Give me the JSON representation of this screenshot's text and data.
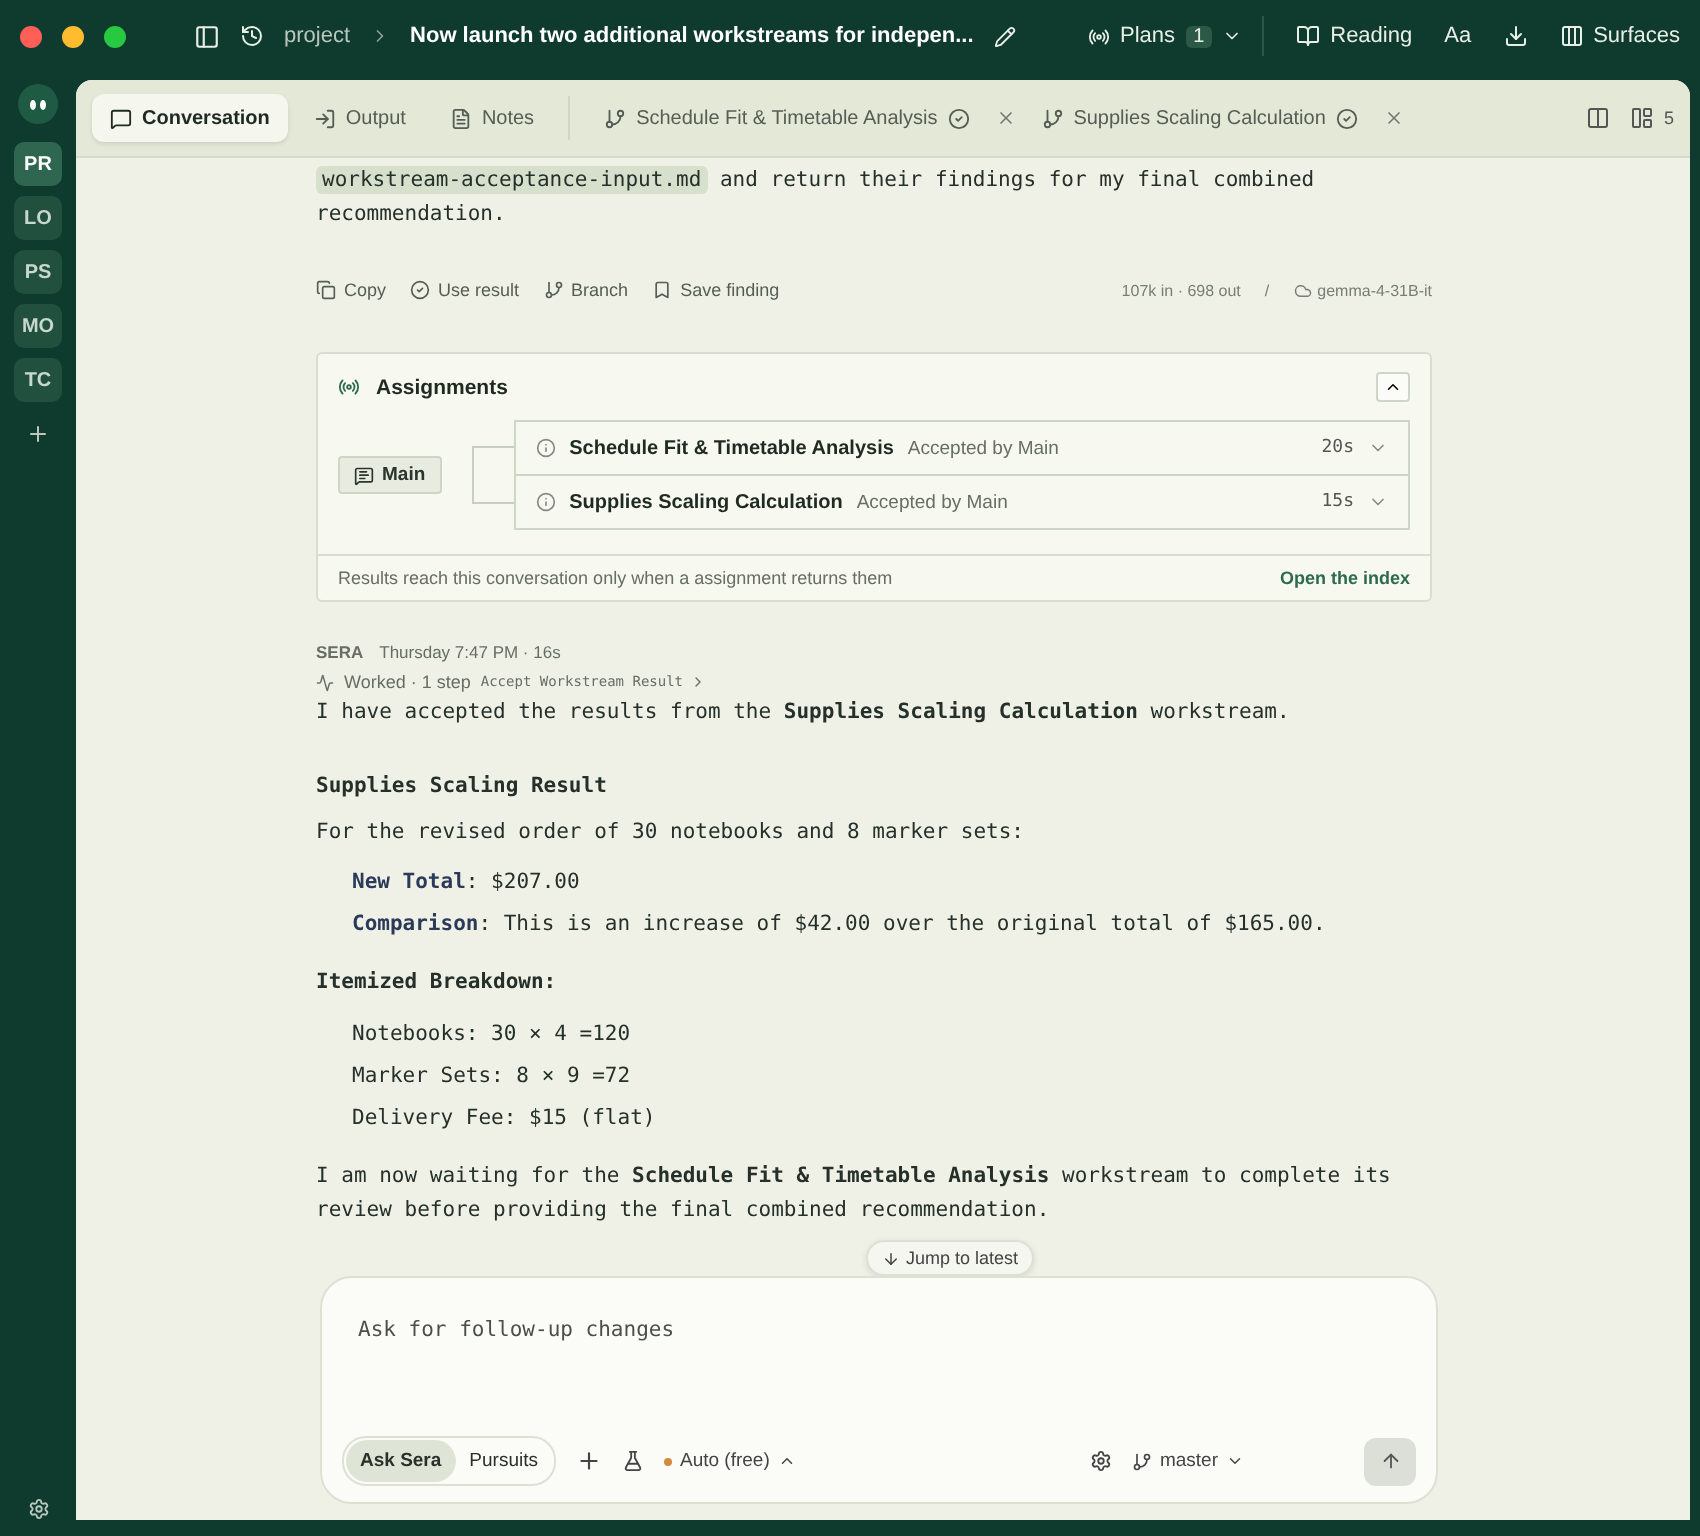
{
  "titlebar": {
    "breadcrumb": "project",
    "title": "Now launch two additional workstreams for indepen...",
    "plans": {
      "label": "Plans",
      "count": "1"
    },
    "actions": [
      {
        "kind": "reading",
        "label": "Reading"
      },
      {
        "kind": "font",
        "label": "Aa"
      },
      {
        "kind": "download"
      },
      {
        "kind": "surfaces",
        "label": "Surfaces"
      }
    ]
  },
  "sidebar": {
    "workspaces": [
      {
        "label": "PR",
        "selected": true
      },
      {
        "label": "LO",
        "selected": false
      },
      {
        "label": "PS",
        "selected": false
      },
      {
        "label": "MO",
        "selected": false
      },
      {
        "label": "TC",
        "selected": false
      }
    ]
  },
  "tabs": [
    {
      "kind": "conversation",
      "label": "Conversation",
      "selected": true
    },
    {
      "kind": "output",
      "label": "Output",
      "selected": false
    },
    {
      "kind": "notes",
      "label": "Notes",
      "selected": false
    },
    {
      "kind": "workstream",
      "label": "Schedule Fit & Timetable Analysis",
      "selected": false
    },
    {
      "kind": "workstream",
      "label": "Supplies Scaling Calculation",
      "selected": false
    }
  ],
  "panel_count": "5",
  "message": {
    "code": "workstream-acceptance-input.md",
    "text": " and return their findings for my final combined recommendation.",
    "actions": [
      {
        "kind": "copy",
        "label": "Copy"
      },
      {
        "kind": "use",
        "label": "Use result"
      },
      {
        "kind": "branch",
        "label": "Branch"
      },
      {
        "kind": "save",
        "label": "Save finding"
      }
    ],
    "usage": "107k in · 698 out",
    "separator": "/",
    "model": "gemma-4-31B-it"
  },
  "assignments": {
    "title": "Assignments",
    "expanded": true,
    "main": "Main",
    "items": [
      {
        "title": "Schedule Fit & Timetable Analysis",
        "status": "Accepted by Main",
        "duration": "20s"
      },
      {
        "title": "Supplies Scaling Calculation",
        "status": "Accepted by Main",
        "duration": "15s"
      }
    ],
    "footer": "Results reach this conversation only when a assignment returns them",
    "link": "Open the index"
  },
  "reply": {
    "author": "SERA",
    "meta": "Thursday 7:47 PM · 16s",
    "worked": "Worked · 1 step",
    "tool": "Accept Workstream Result",
    "intro": "I have accepted the results from the **Supplies Scaling Calculation** workstream.",
    "heading": "Supplies Scaling Result",
    "lead": "For the revised order of 30 notebooks and 8 marker sets:",
    "points": [
      {
        "label": "New Total",
        "text": ": $207.00"
      },
      {
        "label": "Comparison",
        "text": ": This is an increase of $42.00 over the original total of $165.00."
      }
    ],
    "heading2": "Itemized Breakdown:",
    "items": [
      "Notebooks: 30 × 4 =120",
      "Marker Sets: 8 × 9 =72",
      "Delivery Fee: $15 (flat)"
    ],
    "closing": "I am now waiting for the **Schedule Fit & Timetable Analysis** workstream to complete its review before providing the final combined recommendation."
  },
  "jump": "Jump to latest",
  "composer": {
    "placeholder": "Ask for follow-up changes",
    "modes": [
      {
        "label": "Ask Sera",
        "selected": true
      },
      {
        "label": "Pursuits",
        "selected": false
      }
    ],
    "model": "Auto (free)",
    "branch": "master"
  }
}
